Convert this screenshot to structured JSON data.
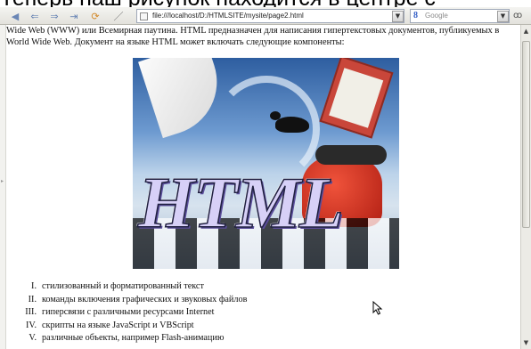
{
  "caption": "Теперь наш рисунок находится в центре с",
  "toolbar": {
    "url": "file:///localhost/D:/HTMLSITE/mysite/page2.html",
    "search_placeholder": "Google"
  },
  "content": {
    "intro": "Wide Web (WWW) или Всемирная паутина. HTML предназначен для написания гипертекстовых документов, публикуемых в World Wide Web. Документ на языке HTML может включать следующие компоненты:",
    "image_title": "HTML",
    "list": [
      {
        "num": "I.",
        "text": "стилизованный и форматированный текст"
      },
      {
        "num": "II.",
        "text": "команды включения графических и звуковых файлов"
      },
      {
        "num": "III.",
        "text": "гиперсвязи с различными ресурсами Internet"
      },
      {
        "num": "IV.",
        "text": "скрипты на языке JavaScript и VBScript"
      },
      {
        "num": "V.",
        "text": "различные объекты, например Flash-анимацию"
      }
    ]
  },
  "icons": {
    "back": "back-arrow-icon",
    "forward": "forward-arrow-icon",
    "home": "home-icon",
    "reload": "reload-icon",
    "stop": "stop-icon",
    "search_engine": "google-icon",
    "reader": "glasses-icon"
  },
  "colors": {
    "toolbar_icon": "#6a86b5",
    "html_logo_fill": "#d7d0f7"
  }
}
